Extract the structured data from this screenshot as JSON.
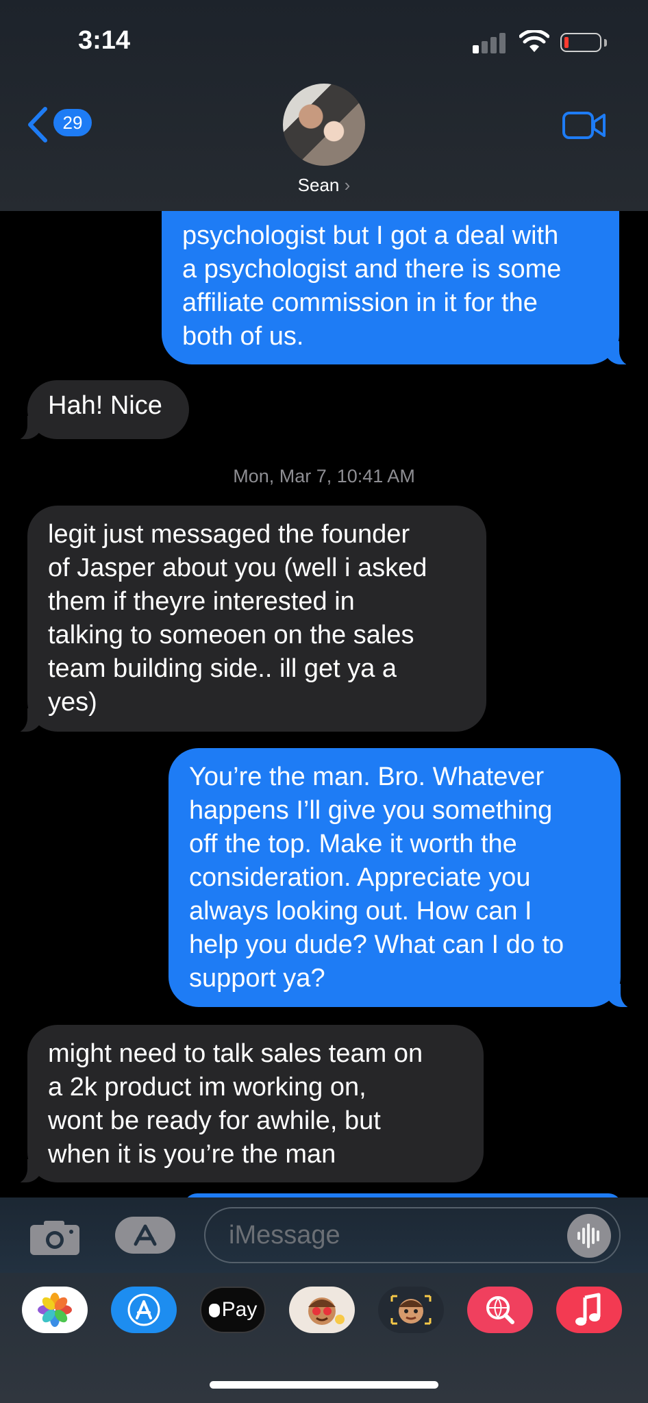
{
  "status_bar": {
    "time": "3:14"
  },
  "nav": {
    "back_count": "29",
    "contact_name": "Sean",
    "contact_chevron": "›"
  },
  "messages": [
    {
      "direction": "outgoing",
      "text": "psychologist but I got a deal with\na psychologist and there is some\naffiliate commission in it for the\nboth of us."
    },
    {
      "direction": "incoming",
      "text": "Hah! Nice"
    },
    {
      "direction": "timestamp",
      "text": "Mon, Mar 7, 10:41 AM"
    },
    {
      "direction": "incoming",
      "text": "legit just messaged the founder\nof Jasper about you (well i asked\nthem if theyre interested in\ntalking to someoen on the sales\nteam building side.. ill get ya a\nyes)"
    },
    {
      "direction": "outgoing",
      "text": "You’re the man. Bro. Whatever\nhappens I’ll give you something\noff the top. Make it worth the\nconsideration. Appreciate you\nalways looking out. How can I\nhelp you dude? What can I do to\nsupport ya?"
    },
    {
      "direction": "incoming",
      "text": "might need to talk sales team on\na 2k product im working on,\nwont be ready for awhile, but\nwhen it is you’re the man"
    }
  ],
  "input": {
    "placeholder": "iMessage"
  },
  "app_tray": {
    "apple_pay_label": "Pay",
    "apps": [
      "photos-icon",
      "app-store-icon",
      "apple-pay-icon",
      "memoji-stickers-icon",
      "animoji-icon",
      "search-images-icon",
      "music-icon"
    ]
  },
  "colors": {
    "outgoing_bubble": "#1e7cf5",
    "incoming_bubble": "#262628",
    "background": "#000000",
    "timestamp_text": "#8e8e93"
  }
}
